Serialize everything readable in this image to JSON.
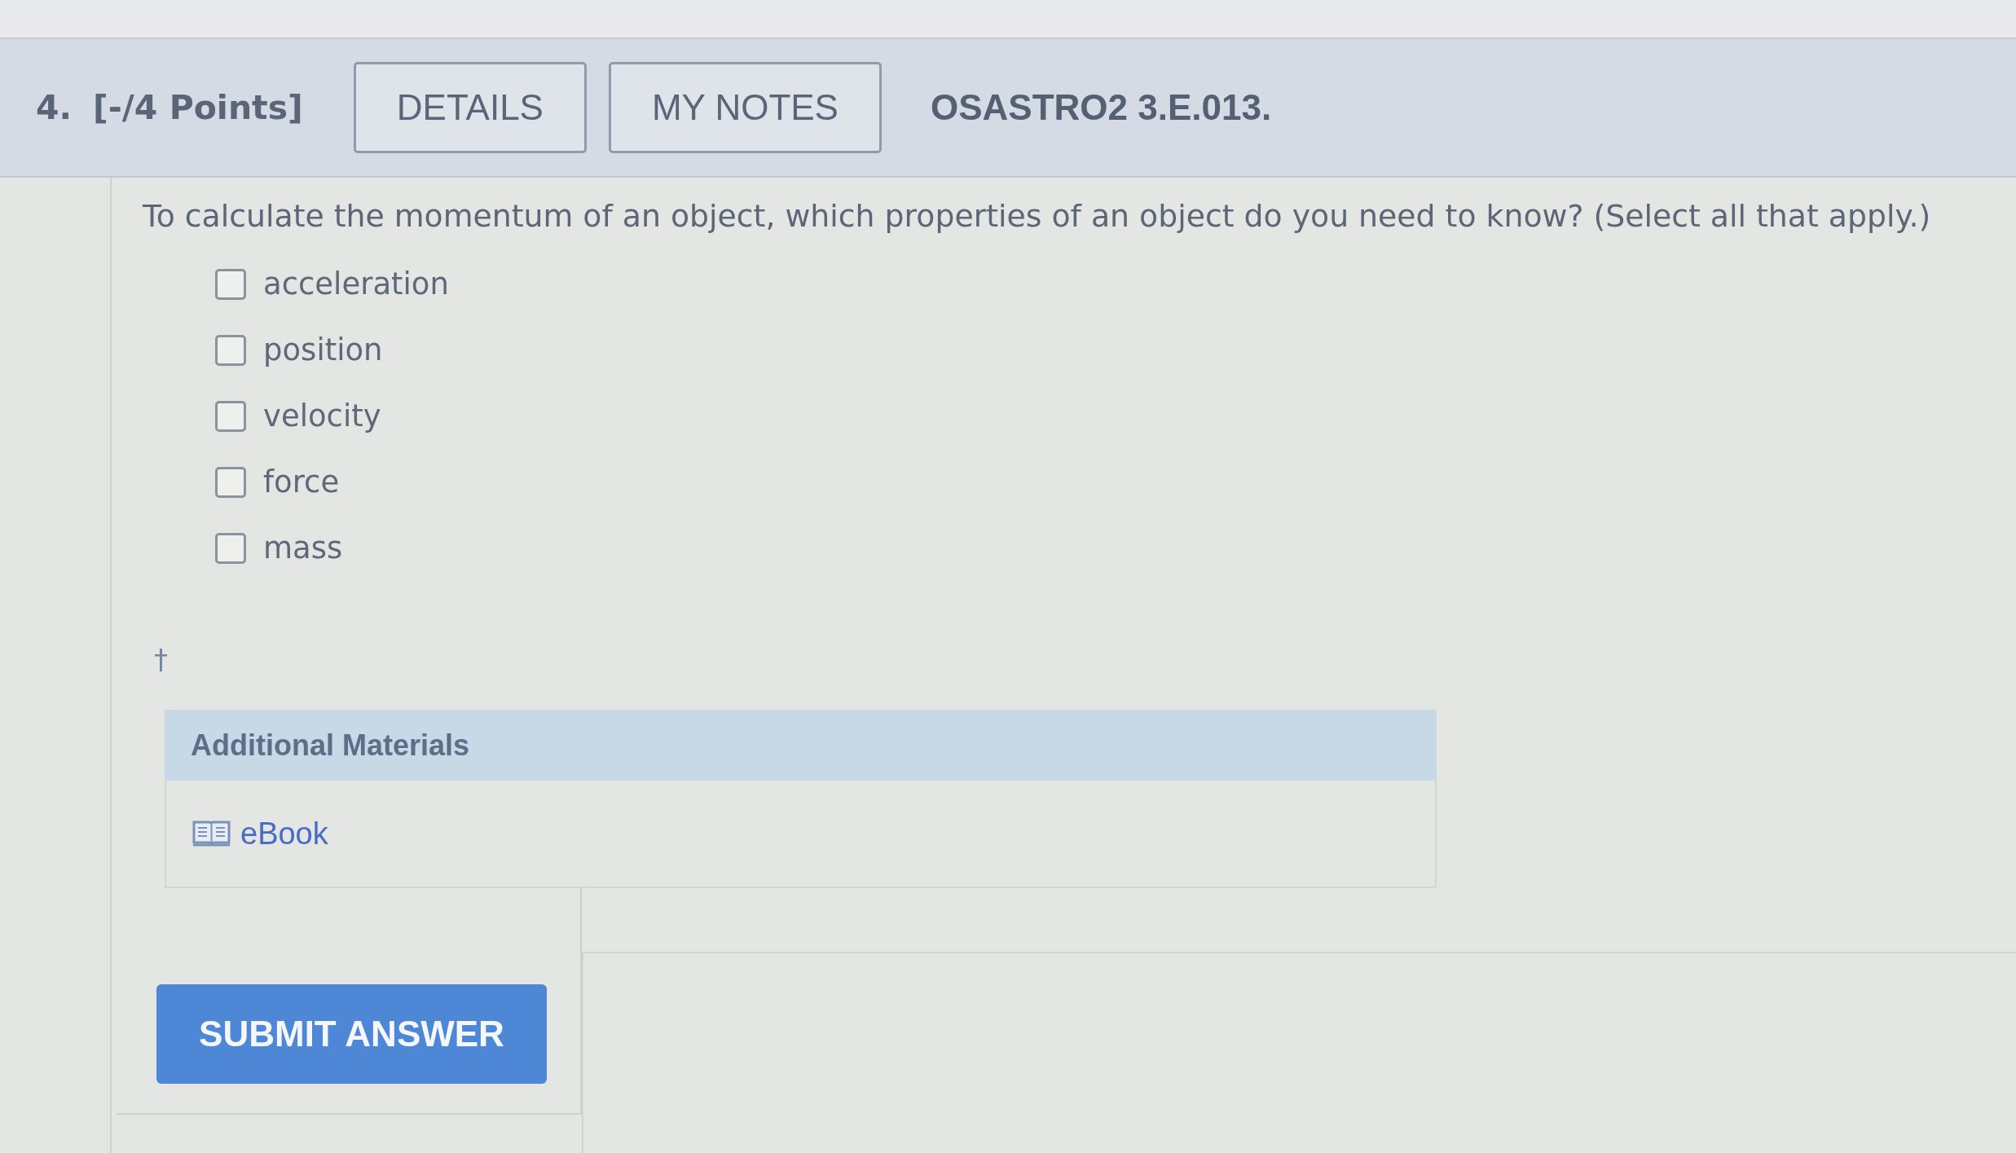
{
  "question_header": {
    "number": "4.",
    "points": "[-/4 Points]",
    "buttons": [
      {
        "label": "DETAILS"
      },
      {
        "label": "MY NOTES"
      }
    ],
    "code": "OSASTRO2 3.E.013."
  },
  "prompt": "To calculate the momentum of an object, which properties of an object do you need to know? (Select all that apply.)",
  "options": [
    {
      "label": "acceleration",
      "checked": false
    },
    {
      "label": "position",
      "checked": false
    },
    {
      "label": "velocity",
      "checked": false
    },
    {
      "label": "force",
      "checked": false
    },
    {
      "label": "mass",
      "checked": false
    }
  ],
  "footnote_mark": "†",
  "additional_materials": {
    "title": "Additional Materials",
    "links": [
      {
        "label": "eBook"
      }
    ]
  },
  "submit_button": {
    "label": "SUBMIT ANSWER"
  }
}
